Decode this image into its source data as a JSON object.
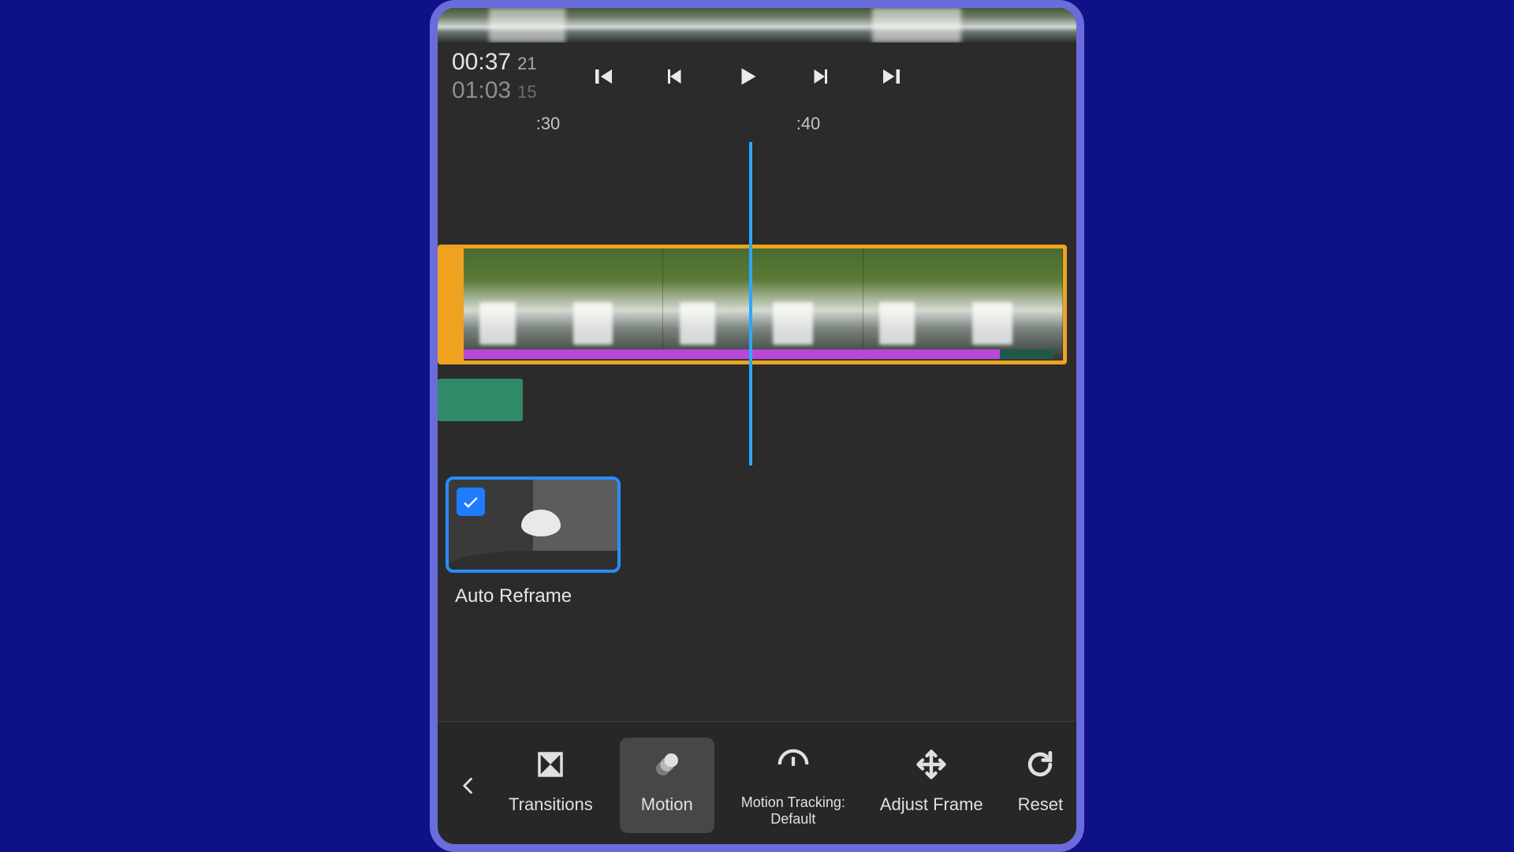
{
  "playback": {
    "current_time": "00:37",
    "current_frames": "21",
    "total_time": "01:03",
    "total_frames": "15"
  },
  "ruler": {
    "mark_a": ":30",
    "mark_b": ":40"
  },
  "option": {
    "auto_reframe_label": "Auto Reframe",
    "checked": true
  },
  "toolbar": {
    "transitions": "Transitions",
    "motion": "Motion",
    "motion_tracking_line1": "Motion Tracking:",
    "motion_tracking_line2": "Default",
    "adjust_frame": "Adjust Frame",
    "reset": "Reset"
  }
}
